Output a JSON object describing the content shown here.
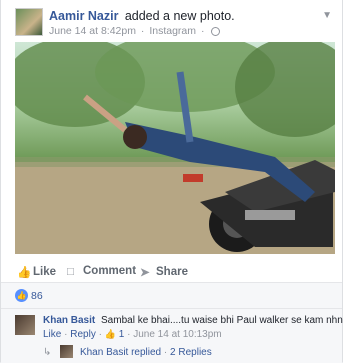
{
  "post": {
    "author": "Aamir Nazir",
    "action": "added a new photo.",
    "date": "June 14 at 8:42pm",
    "separator": "·",
    "source": "Instagram",
    "privacy_icon": "globe-icon",
    "menu_icon": "chevron-down-icon"
  },
  "actions": {
    "like": "Like",
    "comment": "Comment",
    "share": "Share"
  },
  "reactions": {
    "count": "86",
    "icon": "like-icon"
  },
  "comment": {
    "author": "Khan Basit",
    "text": "Sambal ke bhai....tu waise bhi Paul walker se kam nhn h",
    "like": "Like",
    "reply": "Reply",
    "likes": "1",
    "date": "June 14 at 10:13pm",
    "sep": "·"
  },
  "replies": {
    "author_text": "Khan Basit replied",
    "sep": "·",
    "count_text": "2 Replies"
  },
  "colors": {
    "link": "#365899",
    "muted": "#90949c",
    "accent": "#5890ff"
  }
}
